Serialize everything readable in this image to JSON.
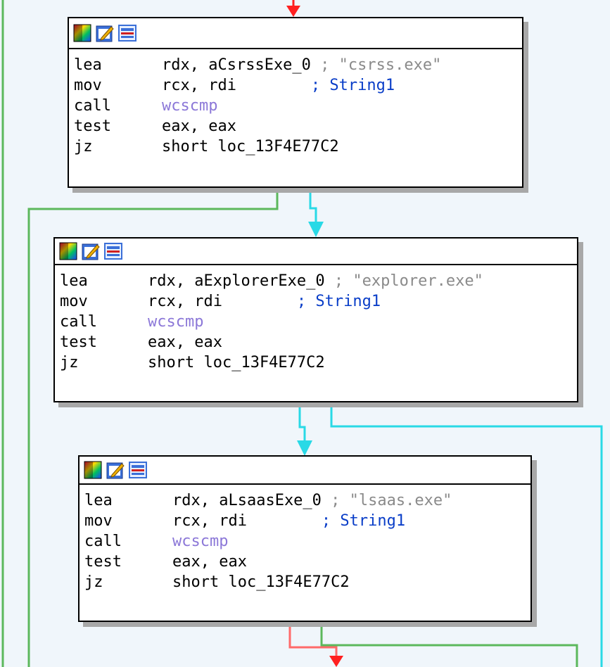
{
  "colors": {
    "background": "#f0f6fb",
    "edge_true": "#5cb85c",
    "edge_false": "#29d9e6",
    "edge_jump": "#ff2020",
    "function_name": "#8c78d8",
    "comment": "#8a8a8a",
    "comment_name": "#0a3ec8"
  },
  "toolbar_icons": [
    "color-palette-icon",
    "edit-pencil-icon",
    "graph-view-icon"
  ],
  "blocks": [
    {
      "lines": [
        {
          "mnemonic": "lea",
          "operands": "rdx, aCsrssExe_0",
          "comment_sep": " ; ",
          "comment": "\"csrss.exe\""
        },
        {
          "mnemonic": "mov",
          "operands": "rcx, rdi",
          "comment_sep": "        ; ",
          "comment": "String1"
        },
        {
          "mnemonic": "call",
          "operands": "wcscmp"
        },
        {
          "mnemonic": "test",
          "operands": "eax, eax"
        },
        {
          "mnemonic": "jz",
          "operands": "short loc_13F4E77C2"
        }
      ]
    },
    {
      "lines": [
        {
          "mnemonic": "lea",
          "operands": "rdx, aExplorerExe_0",
          "comment_sep": " ; ",
          "comment": "\"explorer.exe\""
        },
        {
          "mnemonic": "mov",
          "operands": "rcx, rdi",
          "comment_sep": "        ; ",
          "comment": "String1"
        },
        {
          "mnemonic": "call",
          "operands": "wcscmp"
        },
        {
          "mnemonic": "test",
          "operands": "eax, eax"
        },
        {
          "mnemonic": "jz",
          "operands": "short loc_13F4E77C2"
        }
      ]
    },
    {
      "lines": [
        {
          "mnemonic": "lea",
          "operands": "rdx, aLsaasExe_0",
          "comment_sep": " ; ",
          "comment": "\"lsaas.exe\""
        },
        {
          "mnemonic": "mov",
          "operands": "rcx, rdi",
          "comment_sep": "        ; ",
          "comment": "String1"
        },
        {
          "mnemonic": "call",
          "operands": "wcscmp"
        },
        {
          "mnemonic": "test",
          "operands": "eax, eax"
        },
        {
          "mnemonic": "jz",
          "operands": "short loc_13F4E77C2"
        }
      ]
    }
  ]
}
